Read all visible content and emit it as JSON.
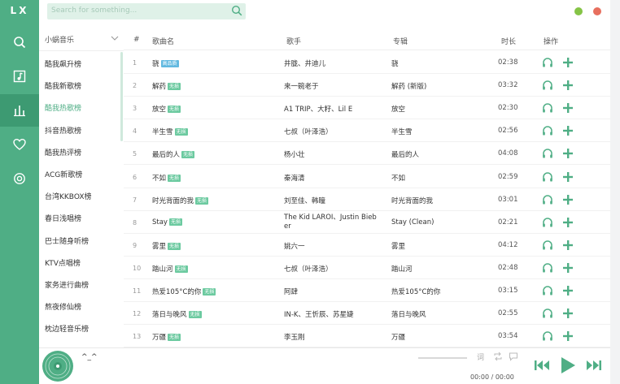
{
  "app": {
    "logo": "LX"
  },
  "nav": {
    "items": [
      "search",
      "music-note",
      "leaderboard",
      "heart",
      "settings"
    ],
    "active_index": 2
  },
  "search": {
    "placeholder": "Search for something..."
  },
  "window_buttons": {
    "minimize_color": "#85c446",
    "close_color": "#e76f5e"
  },
  "sidebar": {
    "source": "小蜗音乐",
    "active_index": 2,
    "items": [
      "酷我飙升榜",
      "酷我新歌榜",
      "酷我热歌榜",
      "抖音热歌榜",
      "酷我热评榜",
      "ACG新歌榜",
      "台湾KKBOX榜",
      "春日浅唱榜",
      "巴士随身听榜",
      "KTV点唱榜",
      "家务进行曲榜",
      "熬夜修仙榜",
      "枕边轻音乐榜"
    ]
  },
  "table": {
    "headers": {
      "num": "#",
      "title": "歌曲名",
      "artist": "歌手",
      "album": "专辑",
      "duration": "时长",
      "actions": "操作"
    },
    "rows": [
      {
        "num": "1",
        "title": "骁",
        "tag": "高品质",
        "tag_color": "#62b9e0",
        "artist": "井胧、井迪儿",
        "album": "骁",
        "duration": "02:38"
      },
      {
        "num": "2",
        "title": "解药",
        "tag": "无损",
        "tag_color": "#6ccaa0",
        "artist": "来一碗老于",
        "album": "解药 (新版)",
        "duration": "03:32"
      },
      {
        "num": "3",
        "title": "放空",
        "tag": "无损",
        "tag_color": "#6ccaa0",
        "artist": "A1 TRIP、大籽、Lil E",
        "album": "放空",
        "duration": "02:30"
      },
      {
        "num": "4",
        "title": "半生雪",
        "tag": "无损",
        "tag_color": "#6ccaa0",
        "artist": "七叔（叶泽浩）",
        "album": "半生雪",
        "duration": "02:56"
      },
      {
        "num": "5",
        "title": "最后的人",
        "tag": "无损",
        "tag_color": "#6ccaa0",
        "artist": "杨小壮",
        "album": "最后的人",
        "duration": "04:08"
      },
      {
        "num": "6",
        "title": "不如",
        "tag": "无损",
        "tag_color": "#6ccaa0",
        "artist": "秦海清",
        "album": "不如",
        "duration": "02:59"
      },
      {
        "num": "7",
        "title": "时光背面的我",
        "tag": "无损",
        "tag_color": "#6ccaa0",
        "artist": "刘至佳、韩瞳",
        "album": "时光背面的我",
        "duration": "03:01"
      },
      {
        "num": "8",
        "title": "Stay",
        "tag": "无损",
        "tag_color": "#6ccaa0",
        "artist_line1": "The Kid LAROI、Justin Bieb",
        "artist_line2": "er",
        "album": "Stay (Clean)",
        "duration": "02:21"
      },
      {
        "num": "9",
        "title": "雾里",
        "tag": "无损",
        "tag_color": "#6ccaa0",
        "artist": "姚六一",
        "album": "雾里",
        "duration": "04:12"
      },
      {
        "num": "10",
        "title": "踏山河",
        "tag": "无损",
        "tag_color": "#6ccaa0",
        "artist": "七叔（叶泽浩）",
        "album": "踏山河",
        "duration": "02:48"
      },
      {
        "num": "11",
        "title": "热爱105°C的你",
        "tag": "无损",
        "tag_color": "#6ccaa0",
        "artist": "阿肆",
        "album": "热爱105°C的你",
        "duration": "03:15"
      },
      {
        "num": "12",
        "title": "落日与晚风",
        "tag": "无损",
        "tag_color": "#6ccaa0",
        "artist": "IN-K、王忻辰、苏星婕",
        "album": "落日与晚风",
        "duration": "02:55"
      },
      {
        "num": "13",
        "title": "万疆",
        "tag": "无损",
        "tag_color": "#6ccaa0",
        "artist": "李玉刚",
        "album": "万疆",
        "duration": "03:54"
      }
    ]
  },
  "player": {
    "track": "^_^",
    "time": "00:00 / 00:00",
    "accent": "#4fae85"
  }
}
